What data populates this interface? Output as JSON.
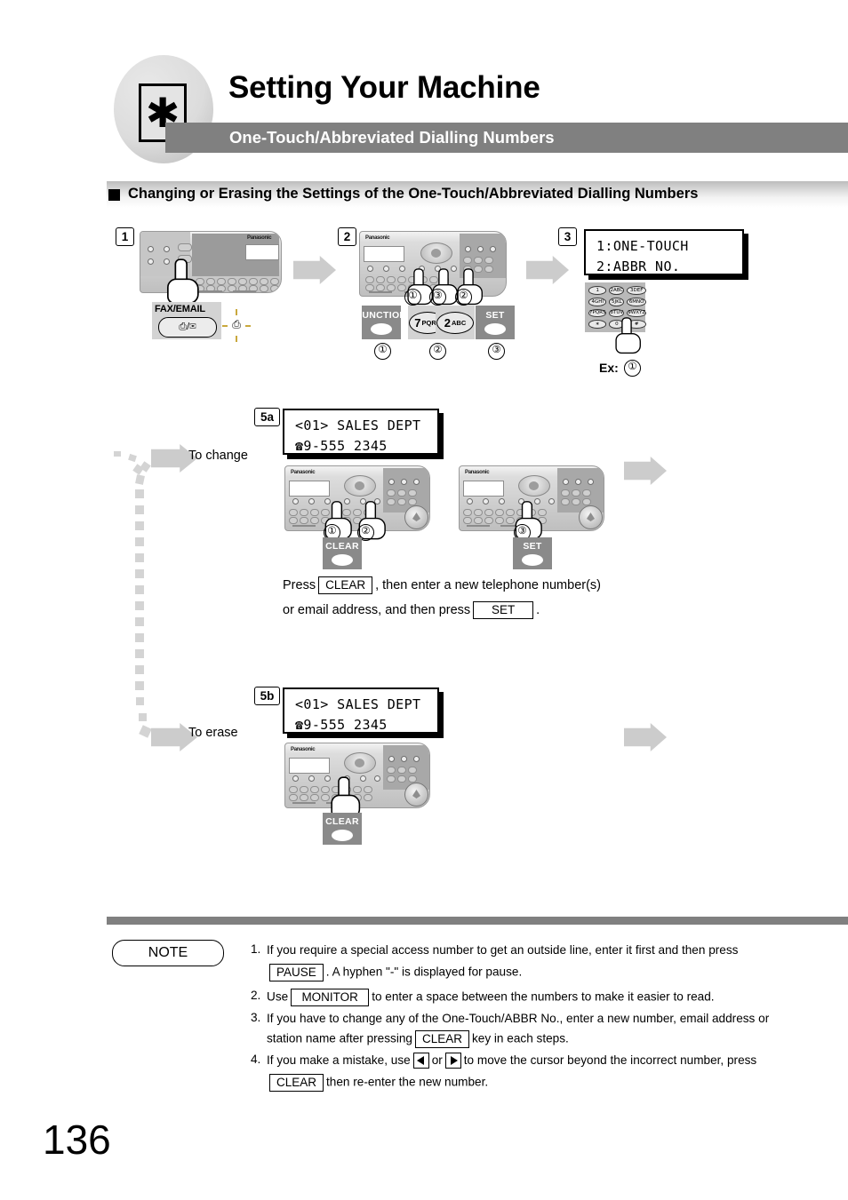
{
  "header": {
    "badge_icon": "asterisk-icon",
    "title": "Setting Your Machine",
    "subtitle": "One-Touch/Abbreviated Dialling Numbers",
    "bar_color": "#808080"
  },
  "section": {
    "heading": "Changing or Erasing the Settings of the One-Touch/Abbreviated Dialling Numbers"
  },
  "steps": {
    "step1": {
      "number": "1",
      "callout_label": "FAX/EMAIL",
      "key_glyph": "⎙/✉",
      "blink_glyph": "⎙"
    },
    "step2": {
      "number": "2",
      "keys": [
        {
          "label": "FUNCTION",
          "order": "①"
        },
        {
          "label": "7",
          "sub": "PQRS",
          "order": "②"
        },
        {
          "label": "2",
          "sub": "ABC",
          "order": "②"
        },
        {
          "label": "SET",
          "order": "③"
        }
      ],
      "hand_orders": [
        "①",
        "③",
        "②"
      ]
    },
    "step3": {
      "number": "3",
      "lcd_line1": "1:ONE-TOUCH",
      "lcd_line2": "2:ABBR NO.",
      "example_label": "Ex:",
      "example_value": "①",
      "keypad_keys": [
        "1",
        "2ABC",
        "3DEF",
        "4GHI",
        "5JKL",
        "6MNO",
        "7PQRS",
        "8TUV",
        "9WXYZ",
        "∗",
        "0",
        "#"
      ]
    },
    "step5a": {
      "number": "5a",
      "lcd_line1": "<01> SALES DEPT",
      "lcd_line2": "☎9-555 2345",
      "branch_label": "To change",
      "callout_clear": "CLEAR",
      "callout_set": "SET",
      "hand_orders": [
        "①",
        "②",
        "③"
      ],
      "instruction_line1_pre": "Press",
      "instruction_line1_key": "CLEAR",
      "instruction_line1_post": ", then enter a new telephone number(s)",
      "instruction_line2_pre": "or email address, and then press",
      "instruction_line2_key": "SET",
      "instruction_line2_post": "."
    },
    "step5b": {
      "number": "5b",
      "lcd_line1": "<01> SALES DEPT",
      "lcd_line2": "☎9-555 2345",
      "branch_label": "To erase",
      "callout_clear": "CLEAR",
      "hand_orders": []
    }
  },
  "note": {
    "badge": "NOTE",
    "items": [
      {
        "num": "1.",
        "line1_pre": "If you require a special access number to get an outside line, enter it first and then press",
        "line2_key": "PAUSE",
        "line2_post": ". A hyphen \"-\" is displayed for pause."
      },
      {
        "num": "2.",
        "line1_pre": "Use",
        "line1_key": "MONITOR",
        "line1_post": "to enter a space between the numbers to make it easier to read."
      },
      {
        "num": "3.",
        "line1_pre": "If you have to change any of the One-Touch/ABBR No., enter a new number, email address or",
        "line2_pre": "station name after pressing",
        "line2_key": "CLEAR",
        "line2_post": "key in each steps."
      },
      {
        "num": "4.",
        "line1_pre": "If you make a mistake, use",
        "line1_mid": "or",
        "line1_post": "to move the cursor beyond the incorrect number, press",
        "line2_key": "CLEAR",
        "line2_post": "then re-enter the new number."
      }
    ]
  },
  "footer": {
    "page_number": "136"
  }
}
